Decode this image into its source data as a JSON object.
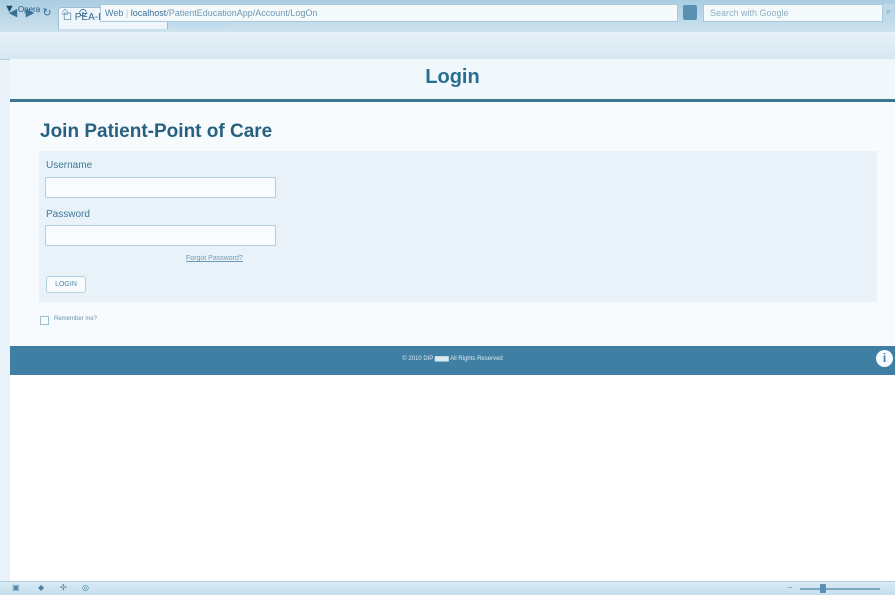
{
  "browser": {
    "logo_label": "Opera",
    "tab_title": "PEA-Demos",
    "tab_close": "×",
    "address_prefix": "Web",
    "address_host": "localhost",
    "address_path": "/PatientEducationApp/Account/LogOn",
    "search_placeholder": "Search with Google",
    "nav_icons": [
      "back-icon",
      "forward-icon",
      "reload-icon",
      "home-icon"
    ]
  },
  "page": {
    "title": "Login",
    "heading": "Join Patient-Point of Care"
  },
  "form": {
    "username_label": "Username",
    "username_value": "",
    "password_label": "Password",
    "password_value": "",
    "forgot_link": "Forgot Password?",
    "login_button": "LOGIN",
    "remember_label": "Remember me?"
  },
  "footer": {
    "copyright": "© 2010 DIP ▆▆▆ All Rights Reserved",
    "info_icon": "i"
  },
  "colors": {
    "accent": "#2a6d93",
    "footer_bg": "#3f7fa3",
    "panel_bg": "#e8f2f8"
  }
}
